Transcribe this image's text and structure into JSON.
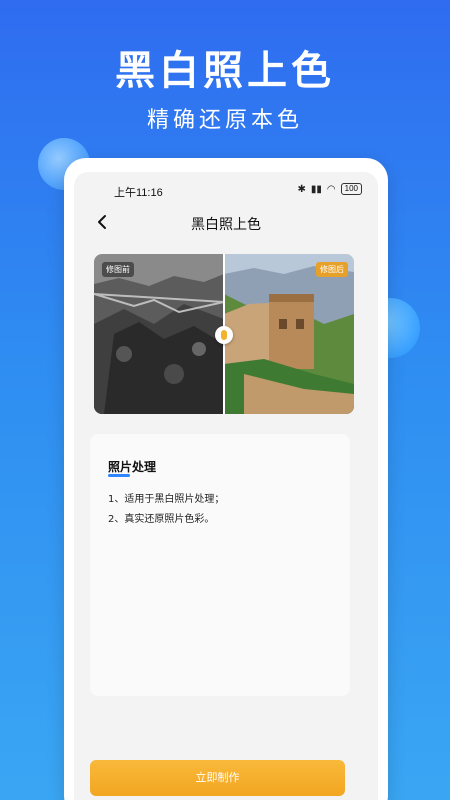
{
  "hero": {
    "title": "黑白照上色",
    "subtitle": "精确还原本色"
  },
  "status_bar": {
    "time": "上午11:16",
    "battery": "100"
  },
  "nav": {
    "title": "黑白照上色"
  },
  "compare": {
    "before_label": "修图前",
    "after_label": "修图后",
    "accent_color": "#e7a12a"
  },
  "info": {
    "title": "照片处理",
    "lines": [
      "1、适用于黑白照片处理；",
      "2、真实还原照片色彩。"
    ]
  },
  "cta": {
    "label": "立即制作",
    "color": "#f2a621"
  },
  "colors": {
    "background": "#2f8df2",
    "accent": "#2f86ff"
  }
}
